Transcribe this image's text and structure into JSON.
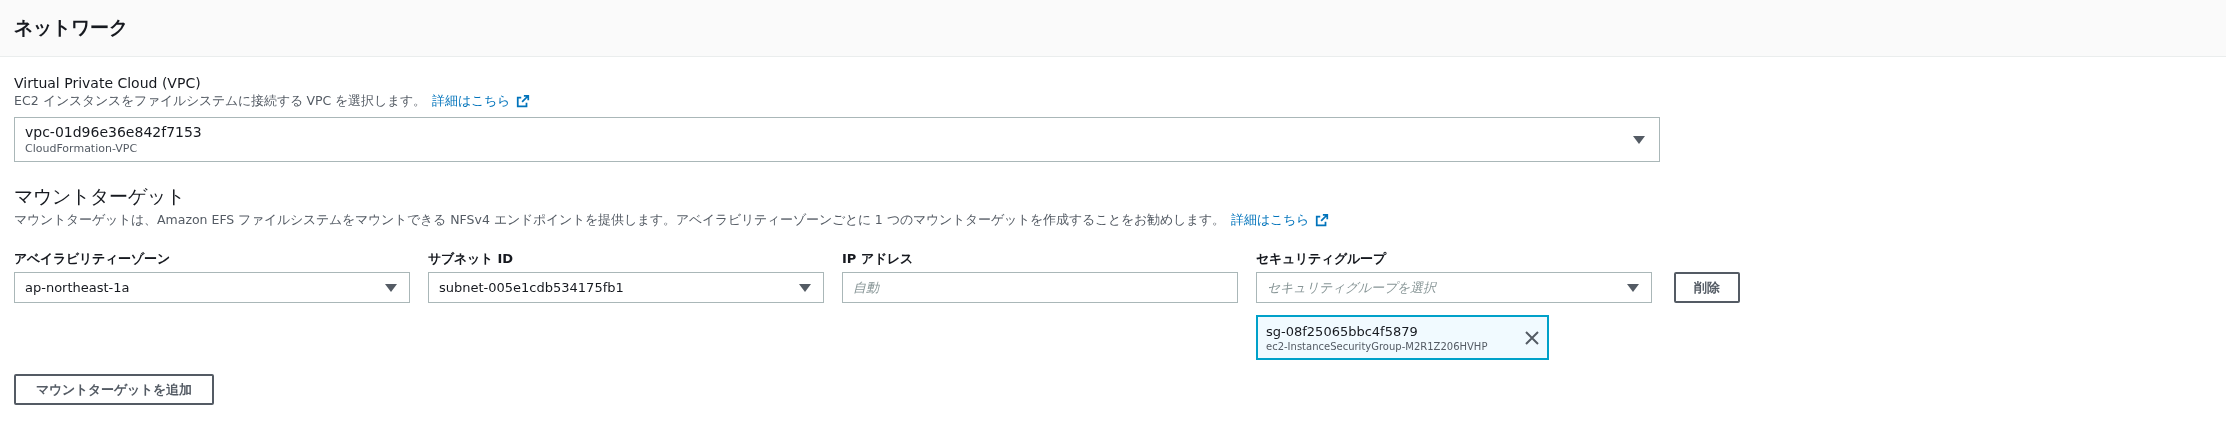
{
  "panel": {
    "title": "ネットワーク"
  },
  "vpc": {
    "label": "Virtual Private Cloud (VPC)",
    "description": "EC2 インスタンスをファイルシステムに接続する VPC を選択します。",
    "link": "詳細はこちら",
    "value": "vpc-01d96e36e842f7153",
    "secondary": "CloudFormation-VPC"
  },
  "mount_targets": {
    "heading": "マウントターゲット",
    "description": "マウントターゲットは、Amazon EFS ファイルシステムをマウントできる NFSv4 エンドポイントを提供します。アベイラビリティーゾーンごとに 1 つのマウントターゲットを作成することをお勧めします。",
    "link": "詳細はこちら",
    "fields": [
      {
        "kind": "select",
        "label": "アベイラビリティーゾーン",
        "value": "ap-northeast-1a"
      },
      {
        "kind": "select",
        "label": "サブネット ID",
        "value": "subnet-005e1cdb534175fb1"
      },
      {
        "kind": "input",
        "label": "IP アドレス",
        "placeholder": "自動"
      },
      {
        "kind": "multiselect",
        "label": "セキュリティグループ",
        "placeholder": "セキュリティグループを選択",
        "tokens": [
          {
            "value": "sg-08f25065bbc4f5879",
            "secondary": "ec2-InstanceSecurityGroup-M2R1Z206HVHP"
          }
        ]
      }
    ],
    "remove_button": "削除",
    "add_button": "マウントターゲットを追加"
  }
}
